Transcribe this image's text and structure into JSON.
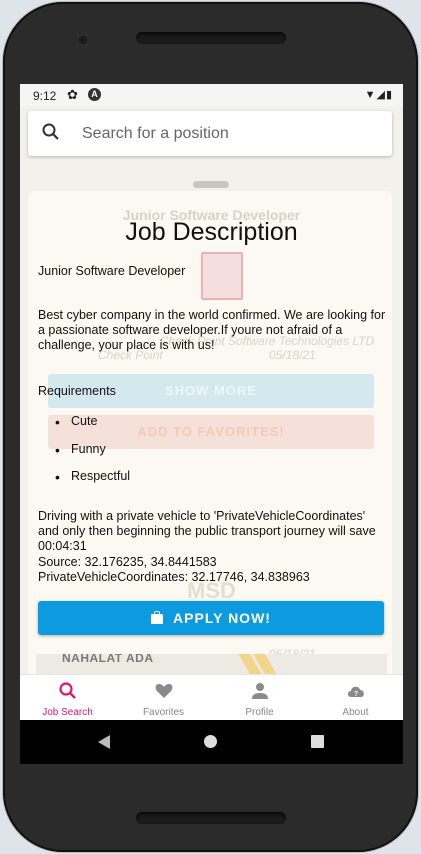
{
  "status_bar": {
    "time": "9:12",
    "icons": "▼◢▮"
  },
  "search": {
    "placeholder": "Search for a position"
  },
  "background": {
    "card_title": "Junior Software Developer",
    "company": "Check Point Software Technologies LTD",
    "location": "Check Point",
    "date": "05/18/21",
    "show_more": "SHOW MORE",
    "add_favorites": "ADD TO FAVORITES!",
    "next_company": "MSD",
    "next_location": "NAHALAT ADA",
    "next_date": "05/18/21"
  },
  "job": {
    "heading": "Job Description",
    "title": "Junior Software Developer",
    "description": "Best cyber company in the world confirmed. We are looking for a passionate software developer.If youre not afraid of a challenge, your place is with us!",
    "requirements_label": "Requirements",
    "requirements": [
      "Cute",
      "Funny",
      "Respectful"
    ],
    "commute_text": "Driving with a private vehicle to 'PrivateVehicleCoordinates' and only then beginning the public transport journey will save 00:04:31",
    "source": "Source: 32.176235, 34.8441583",
    "private_coords": "PrivateVehicleCoordinates: 32.17746, 34.838963",
    "apply_label": "APPLY NOW!"
  },
  "bottom_nav": {
    "items": [
      {
        "label": "Job Search",
        "icon": "search-icon",
        "active": true
      },
      {
        "label": "Favorites",
        "icon": "heart-icon",
        "active": false
      },
      {
        "label": "Profile",
        "icon": "person-icon",
        "active": false
      },
      {
        "label": "About",
        "icon": "cloud-help-icon",
        "active": false
      }
    ]
  },
  "colors": {
    "accent": "#e0156e",
    "primary": "#0d9be0"
  }
}
